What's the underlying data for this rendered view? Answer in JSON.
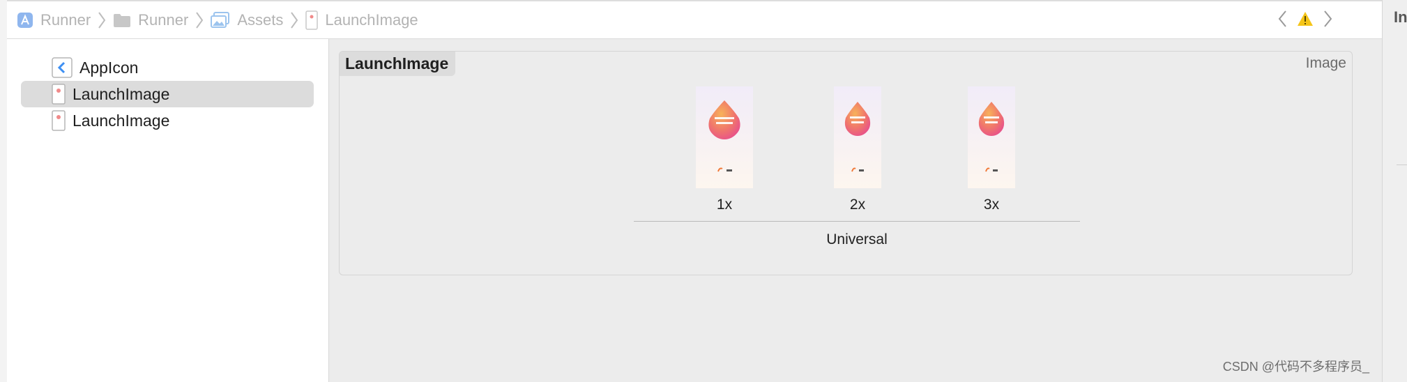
{
  "breadcrumb": {
    "items": [
      {
        "label": "Runner",
        "icon": "xcode-project-icon"
      },
      {
        "label": "Runner",
        "icon": "folder-icon"
      },
      {
        "label": "Assets",
        "icon": "asset-catalog-icon"
      },
      {
        "label": "LaunchImage",
        "icon": "image-set-icon"
      }
    ]
  },
  "navigator": {
    "items": [
      {
        "label": "AppIcon",
        "icon": "app-icon-set-icon",
        "selected": false
      },
      {
        "label": "LaunchImage",
        "icon": "image-set-icon",
        "selected": true
      },
      {
        "label": "LaunchImage",
        "icon": "image-set-icon",
        "selected": false
      }
    ]
  },
  "editor": {
    "set_name": "LaunchImage",
    "set_type": "Image",
    "slots": [
      {
        "label": "1x"
      },
      {
        "label": "2x"
      },
      {
        "label": "3x"
      }
    ],
    "group_label": "Universal"
  },
  "inspector": {
    "title": "In"
  },
  "watermark": "CSDN @代码不多程序员_",
  "colors": {
    "selection": "#dcdcdc",
    "warning": "#f5c518",
    "accent": "#3d8ff3"
  }
}
